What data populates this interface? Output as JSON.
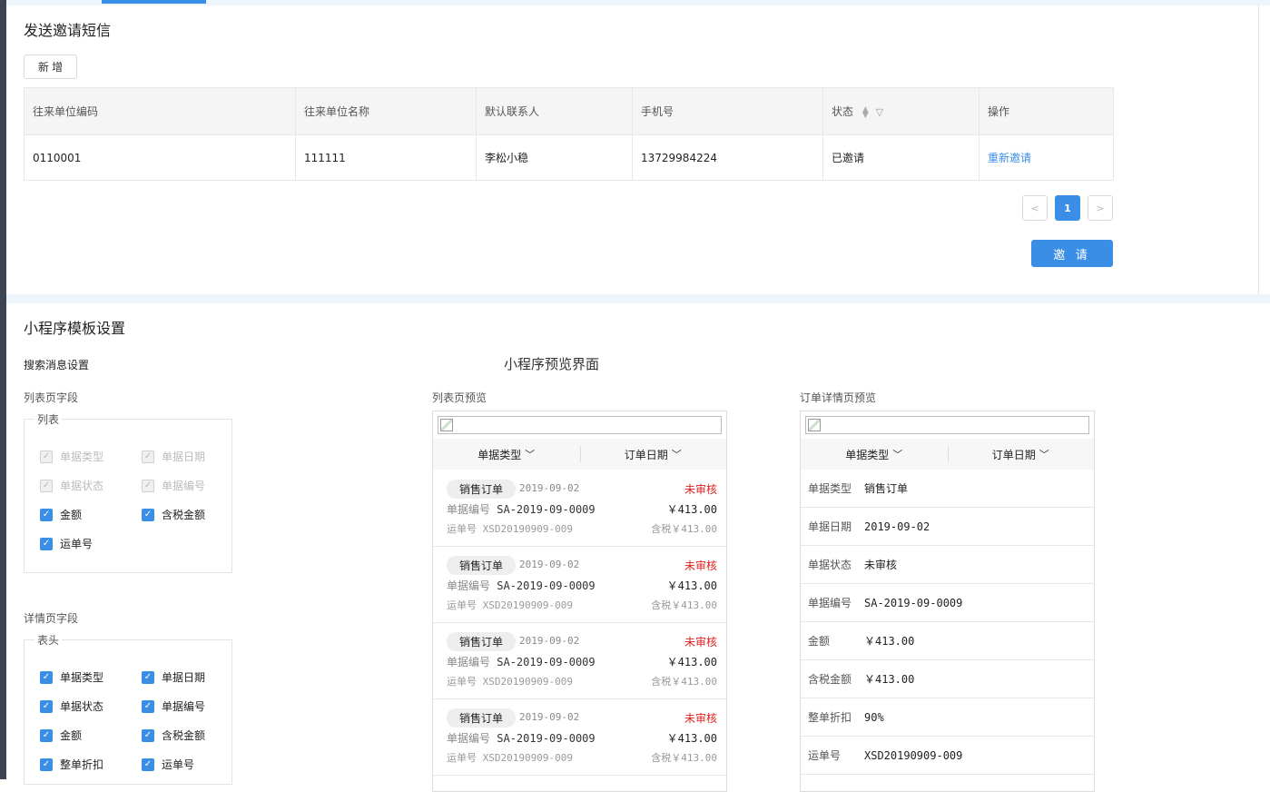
{
  "colors": {
    "accent": "#3a8ee6",
    "status_red": "#e02020",
    "sidebar": "#3d4452"
  },
  "invite": {
    "title": "发送邀请短信",
    "add_button": "新 增",
    "columns": [
      "往来单位编码",
      "往来单位名称",
      "默认联系人",
      "手机号",
      "状态",
      "操作"
    ],
    "rows": [
      {
        "code": "0110001",
        "name": "111111",
        "contact": "李松小稳",
        "phone": "13729984224",
        "status": "已邀请",
        "action": "重新邀请"
      }
    ],
    "pager": {
      "prev": "<",
      "current": "1",
      "next": ">"
    },
    "invite_button": "邀 请"
  },
  "template": {
    "title": "小程序模板设置",
    "search_settings": "搜索消息设置",
    "preview_title": "小程序预览界面",
    "list_fields_label": "列表页字段",
    "list_group": "列表",
    "list_fields": [
      {
        "label": "单据类型",
        "checked": true,
        "disabled": true
      },
      {
        "label": "单据日期",
        "checked": true,
        "disabled": true
      },
      {
        "label": "单据状态",
        "checked": true,
        "disabled": true
      },
      {
        "label": "单据编号",
        "checked": true,
        "disabled": true
      },
      {
        "label": "金额",
        "checked": true,
        "disabled": false
      },
      {
        "label": "含税金额",
        "checked": true,
        "disabled": false
      },
      {
        "label": "运单号",
        "checked": true,
        "disabled": false
      }
    ],
    "detail_fields_label": "详情页字段",
    "detail_group": "表头",
    "detail_fields": [
      {
        "label": "单据类型",
        "checked": true
      },
      {
        "label": "单据日期",
        "checked": true
      },
      {
        "label": "单据状态",
        "checked": true
      },
      {
        "label": "单据编号",
        "checked": true
      },
      {
        "label": "金额",
        "checked": true
      },
      {
        "label": "含税金额",
        "checked": true
      },
      {
        "label": "整单折扣",
        "checked": true
      },
      {
        "label": "运单号",
        "checked": true
      }
    ],
    "list_preview": {
      "label": "列表页预览",
      "filter1": "单据类型",
      "filter2": "订单日期",
      "cards": [
        {
          "tag": "销售订单",
          "date": "2019-09-02",
          "status": "未审核",
          "no_label": "单据编号",
          "no": "SA-2019-09-0009",
          "amount": "￥413.00",
          "ship": "运单号 XSD20190909-009",
          "tax": "含税￥413.00"
        },
        {
          "tag": "销售订单",
          "date": "2019-09-02",
          "status": "未审核",
          "no_label": "单据编号",
          "no": "SA-2019-09-0009",
          "amount": "￥413.00",
          "ship": "运单号 XSD20190909-009",
          "tax": "含税￥413.00"
        },
        {
          "tag": "销售订单",
          "date": "2019-09-02",
          "status": "未审核",
          "no_label": "单据编号",
          "no": "SA-2019-09-0009",
          "amount": "￥413.00",
          "ship": "运单号 XSD20190909-009",
          "tax": "含税￥413.00"
        },
        {
          "tag": "销售订单",
          "date": "2019-09-02",
          "status": "未审核",
          "no_label": "单据编号",
          "no": "SA-2019-09-0009",
          "amount": "￥413.00",
          "ship": "运单号 XSD20190909-009",
          "tax": "含税￥413.00"
        }
      ]
    },
    "detail_preview": {
      "label": "订单详情页预览",
      "filter1": "单据类型",
      "filter2": "订单日期",
      "rows": [
        {
          "k": "单据类型",
          "v": "销售订单"
        },
        {
          "k": "单据日期",
          "v": "2019-09-02"
        },
        {
          "k": "单据状态",
          "v": "未审核"
        },
        {
          "k": "单据编号",
          "v": "SA-2019-09-0009"
        },
        {
          "k": "金额",
          "v": "￥413.00"
        },
        {
          "k": "含税金额",
          "v": "￥413.00"
        },
        {
          "k": "整单折扣",
          "v": "90%"
        },
        {
          "k": "运单号",
          "v": "XSD20190909-009"
        }
      ]
    }
  }
}
